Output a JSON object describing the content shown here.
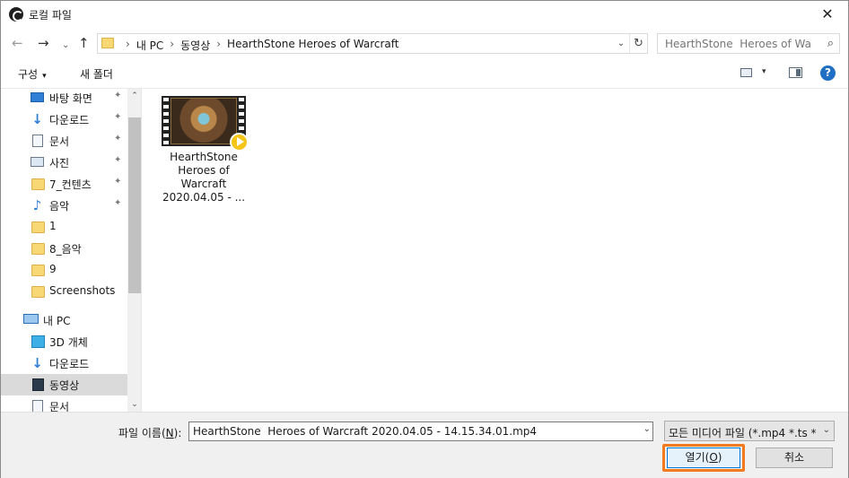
{
  "window": {
    "title": "로컬 파일",
    "close_glyph": "✕"
  },
  "nav": {
    "back_glyph": "←",
    "forward_glyph": "→",
    "recent_glyph": "⌄",
    "up_glyph": "↑",
    "breadcrumbs": [
      "내 PC",
      "동영상",
      "HearthStone  Heroes of Warcraft"
    ],
    "crumb_separator": "›",
    "dropdown_glyph": "⌄",
    "refresh_glyph": "↻",
    "search_placeholder": "HearthStone  Heroes of War...",
    "search_glyph": "⌕"
  },
  "toolbar": {
    "organize_label": "구성",
    "organize_caret": "▾",
    "new_folder_label": "새 폴더",
    "view_caret": "▾",
    "help_glyph": "?"
  },
  "sidebar": {
    "pin_glyph": "✦",
    "items": [
      {
        "label": "바탕 화면",
        "icon": "desktop-icon",
        "pinned": true
      },
      {
        "label": "다운로드",
        "icon": "download-icon",
        "pinned": true
      },
      {
        "label": "문서",
        "icon": "document-icon",
        "pinned": true
      },
      {
        "label": "사진",
        "icon": "pictures-icon",
        "pinned": true
      },
      {
        "label": "7_컨텐츠",
        "icon": "folder-icon",
        "pinned": true
      },
      {
        "label": "음악",
        "icon": "music-icon",
        "pinned": true
      },
      {
        "label": "1",
        "icon": "folder-icon",
        "pinned": false
      },
      {
        "label": "8_음악",
        "icon": "folder-icon",
        "pinned": false
      },
      {
        "label": "9",
        "icon": "folder-icon",
        "pinned": false
      },
      {
        "label": "Screenshots",
        "icon": "folder-icon",
        "pinned": false
      },
      {
        "label": "내 PC",
        "icon": "pc-icon",
        "pinned": false
      },
      {
        "label": "3D 개체",
        "icon": "3d-objects-icon",
        "pinned": false
      },
      {
        "label": "다운로드",
        "icon": "download-icon",
        "pinned": false
      },
      {
        "label": "동영상",
        "icon": "video-icon",
        "pinned": false,
        "selected": true
      },
      {
        "label": "문서",
        "icon": "document-icon",
        "pinned": false
      }
    ],
    "scroll_up_glyph": "⌃",
    "scroll_down_glyph": "⌄"
  },
  "files": [
    {
      "name": "HearthStone Heroes of Warcraft 2020.04.05 - ..."
    }
  ],
  "footer": {
    "filename_label_prefix": "파일 이름(",
    "filename_label_key": "N",
    "filename_label_suffix": "):",
    "filename_value": "HearthStone  Heroes of Warcraft 2020.04.05 - 14.15.34.01.mp4",
    "filename_dropdown_glyph": "⌄",
    "filter_value": "모든 미디어 파일 (*.mp4 *.ts *",
    "filter_dropdown_glyph": "⌄",
    "open_label_prefix": "열기(",
    "open_label_key": "O",
    "open_label_suffix": ")",
    "cancel_label": "취소"
  },
  "colors": {
    "accent": "#0078d7",
    "highlight_ring": "#f47a20",
    "selected_bg": "#dadada",
    "folder": "#f8d775"
  }
}
